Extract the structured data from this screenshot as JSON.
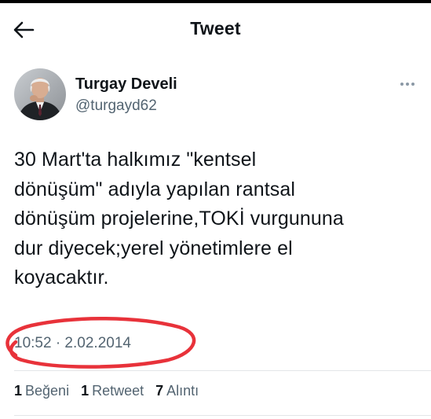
{
  "header": {
    "title": "Tweet"
  },
  "author": {
    "display_name": "Turgay Develi",
    "handle": "@turgayd62"
  },
  "tweet": {
    "text": "30 Mart'ta halkımız \"kentsel\ndönüşüm\" adıyla yapılan rantsal\ndönüşüm projelerine,TOKİ vurgununa\ndur diyecek;yerel yönetimlere el\nkoyacaktır.",
    "timestamp": "10:52 · 2.02.2014"
  },
  "stats": {
    "likes_count": "1",
    "likes_label": "Beğeni",
    "retweets_count": "1",
    "retweets_label": "Retweet",
    "quotes_count": "7",
    "quotes_label": "Alıntı"
  },
  "colors": {
    "text_primary": "#0f1419",
    "text_secondary": "#536471",
    "highlight_annotation": "#e8323a"
  },
  "icons": {
    "back": "arrow-left-icon",
    "more": "more-horizontal-icon"
  }
}
